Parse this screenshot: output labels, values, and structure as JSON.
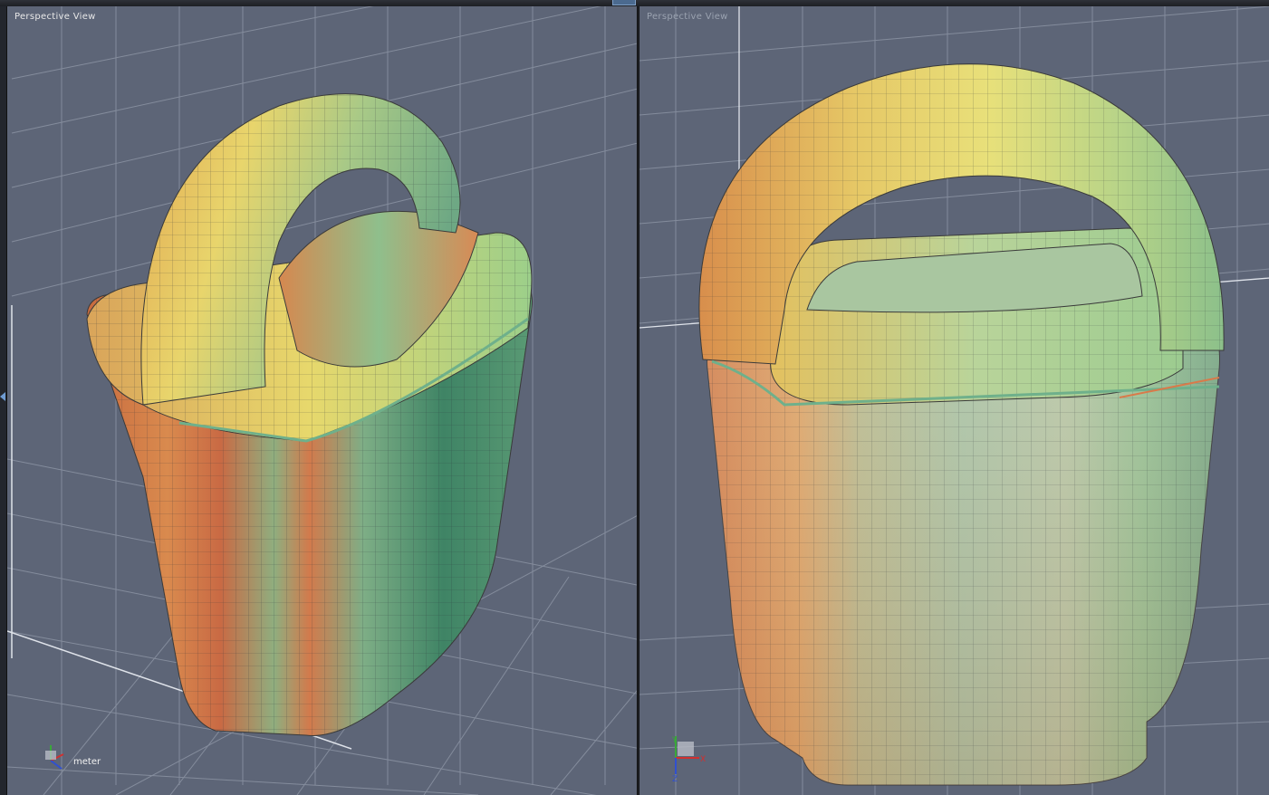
{
  "app": {
    "viewports": [
      {
        "title": "Perspective View"
      },
      {
        "title": "Perspective View"
      }
    ],
    "units": "meter",
    "axes": {
      "x": "X",
      "y": "Y",
      "z": "Z"
    }
  },
  "colors": {
    "viewport_bg": "#5d6577",
    "grid_line": "#8b93a3",
    "frame": "#23262d",
    "accent": "#6f9bd2",
    "axis_x": "#d03030",
    "axis_y": "#3aa83a",
    "axis_z": "#3050d0",
    "model_warm": "#d97a4a",
    "model_yellow": "#e6d26a",
    "model_green": "#7fb08a",
    "model_dark_green": "#3e7f62"
  }
}
